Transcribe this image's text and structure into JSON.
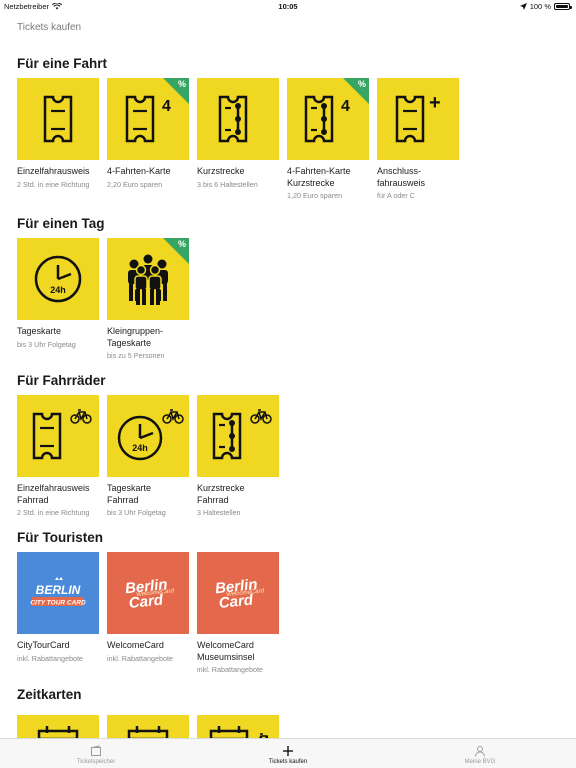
{
  "status": {
    "carrier": "Netzbetreiber",
    "time": "10:05",
    "battery": "100 %",
    "battery_level": 1.0
  },
  "nav": {
    "title": "Tickets kaufen"
  },
  "colors": {
    "tile_yellow": "#f0d722",
    "badge_green": "#37a664",
    "tourist_blue": "#4a8ad8",
    "tourist_red": "#e4684b"
  },
  "sections": [
    {
      "title": "Für eine Fahrt",
      "tiles": [
        {
          "name": "Einzelfahrausweis",
          "sub": "2 Std. in eine Richtung",
          "icon": "ticket-icon"
        },
        {
          "name": "4-Fahrten-Karte",
          "sub": "2,20 Euro sparen",
          "icon": "ticket-4-icon",
          "badge": "%",
          "count": "4"
        },
        {
          "name": "Kurzstrecke",
          "sub": "3 bis 6 Haltestellen",
          "icon": "short-trip-ticket-icon"
        },
        {
          "name": "4-Fahrten-Karte Kurzstrecke",
          "sub": "1,20 Euro sparen",
          "icon": "short-trip-4-icon",
          "badge": "%",
          "count": "4"
        },
        {
          "name": "Anschluss-fahrausweis",
          "sub": "für A oder C",
          "icon": "connection-ticket-icon",
          "plus": "+"
        }
      ]
    },
    {
      "title": "Für einen Tag",
      "tiles": [
        {
          "name": "Tageskarte",
          "sub": "bis 3 Uhr Folgetag",
          "icon": "clock-24h-icon",
          "clock_label": "24h"
        },
        {
          "name": "Kleingruppen-Tageskarte",
          "sub": "bis zu 5 Personen",
          "icon": "group-icon",
          "badge": "%"
        }
      ]
    },
    {
      "title": "Für Fahrräder",
      "tiles": [
        {
          "name": "Einzelfahrausweis Fahrrad",
          "sub": "2 Std. in eine Richtung",
          "icon": "bike-ticket-icon"
        },
        {
          "name": "Tageskarte Fahrrad",
          "sub": "bis 3 Uhr Folgetag",
          "icon": "bike-clock-icon",
          "clock_label": "24h"
        },
        {
          "name": "Kurzstrecke Fahrrad",
          "sub": "3 Haltestellen",
          "icon": "bike-short-trip-icon"
        }
      ]
    },
    {
      "title": "Für Touristen",
      "tiles": [
        {
          "name": "CityTourCard",
          "sub": "inkl. Rabattangebote",
          "icon": "citytourcard-logo",
          "logo_line1": "BERLIN",
          "logo_line2": "CITY TOUR CARD"
        },
        {
          "name": "WelcomeCard",
          "sub": "inkl. Rabattangebote",
          "icon": "welcomecard-logo",
          "logo_line1": "Berlin",
          "logo_line2": "Card",
          "logo_overlay": "WelcomeCard"
        },
        {
          "name": "WelcomeCard Museumsinsel",
          "sub": "inkl. Rabattangebote",
          "icon": "welcomecard-museum-logo",
          "logo_line1": "Berlin",
          "logo_line2": "Card",
          "logo_overlay": "WelcomeCard"
        }
      ]
    },
    {
      "title": "Zeitkarten",
      "tiles": []
    }
  ],
  "tabbar": [
    {
      "label": "Ticketspeicher",
      "icon": "wallet-icon",
      "active": false
    },
    {
      "label": "Tickets kaufen",
      "icon": "plus-icon",
      "active": true
    },
    {
      "label": "Meine BVG",
      "icon": "person-icon",
      "active": false
    }
  ]
}
